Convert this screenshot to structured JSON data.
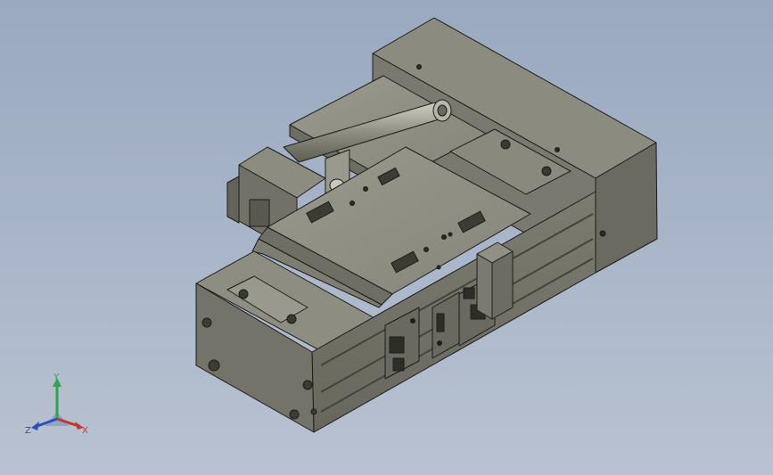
{
  "viewport": {
    "background_top": "#9aa9bf",
    "background_bottom": "#b9c2d2",
    "model_colors": {
      "face_light": "#8f8e82",
      "face_mid": "#77766b",
      "face_dark": "#5c5c52",
      "edge": "#1c1c1a",
      "rail_groove": "#44443c"
    }
  },
  "triad": {
    "x_label": "X",
    "y_label": "Y",
    "z_label": "Z",
    "x_color": "#c0392b",
    "y_color": "#27a84a",
    "z_color": "#2c4fbf"
  }
}
